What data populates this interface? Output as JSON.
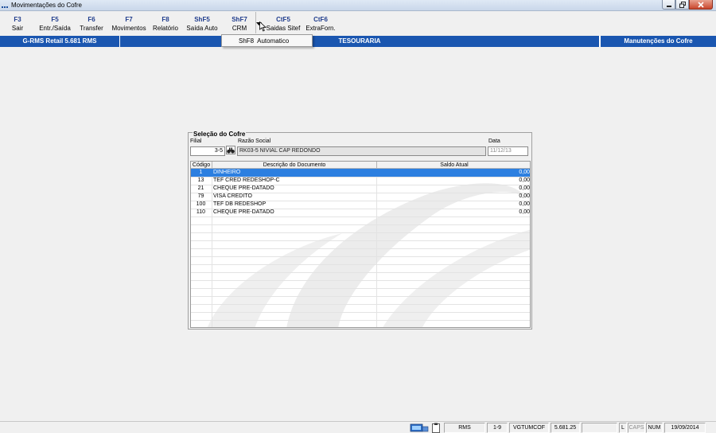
{
  "window": {
    "title": "Movimentações do Cofre"
  },
  "toolbar": {
    "buttons": [
      {
        "key": "F3",
        "label": "Sair"
      },
      {
        "key": "F5",
        "label": "Entr./Saída"
      },
      {
        "key": "F6",
        "label": "Transfer"
      },
      {
        "key": "F7",
        "label": "Movimentos"
      },
      {
        "key": "F8",
        "label": "Relatório"
      },
      {
        "key": "ShF5",
        "label": "Saída Auto"
      },
      {
        "key": "ShF7",
        "label": "CRM"
      },
      {
        "key": "CtF5",
        "label": "Saidas Sitef"
      },
      {
        "key": "CtF6",
        "label": "ExtraForn."
      }
    ],
    "dropdown_item": "ShF8  Automatico"
  },
  "infobar": {
    "left": "G-RMS Retail 5.681 RMS",
    "center": "TESOURARIA",
    "right": "Manutenções do Cofre"
  },
  "panel": {
    "legend": "Seleção do Cofre",
    "filial_label": "Filial",
    "filial_value": "3-5",
    "razao_label": "Razão Social",
    "razao_value": "RK03-5 NIVIAL CAP REDONDO",
    "data_label": "Data",
    "data_value": "11/12/13"
  },
  "grid": {
    "headers": {
      "code": "Código",
      "desc": "Descrição do Documento",
      "bal": "Saldo Atual"
    },
    "rows": [
      {
        "code": "1",
        "desc": "DINHEIRO",
        "bal": "0,00",
        "selected": true
      },
      {
        "code": "13",
        "desc": "TEF CRED REDESHOP-C",
        "bal": "0,00"
      },
      {
        "code": "21",
        "desc": "CHEQUE PRE-DATADO",
        "bal": "0,00"
      },
      {
        "code": "79",
        "desc": "VISA CREDITO",
        "bal": "0,00"
      },
      {
        "code": "100",
        "desc": "TEF DB REDESHOP",
        "bal": "0,00"
      },
      {
        "code": "110",
        "desc": "CHEQUE PRE-DATADO",
        "bal": "0,00"
      }
    ]
  },
  "statusbar": {
    "system": "RMS",
    "page": "1-9",
    "program": "VGTUMCOF",
    "version": "5.681.25",
    "lock": "L",
    "caps": "CAPS",
    "num": "NUM",
    "date": "19/09/2014"
  },
  "colors": {
    "accent": "#1a56b0",
    "selection": "#2c7fe0",
    "key_text": "#1f3c8c"
  },
  "icons": {
    "app": "app-grid-icon",
    "search": "binoculars-icon",
    "network": "network-icon",
    "clipboard": "clipboard-icon"
  }
}
